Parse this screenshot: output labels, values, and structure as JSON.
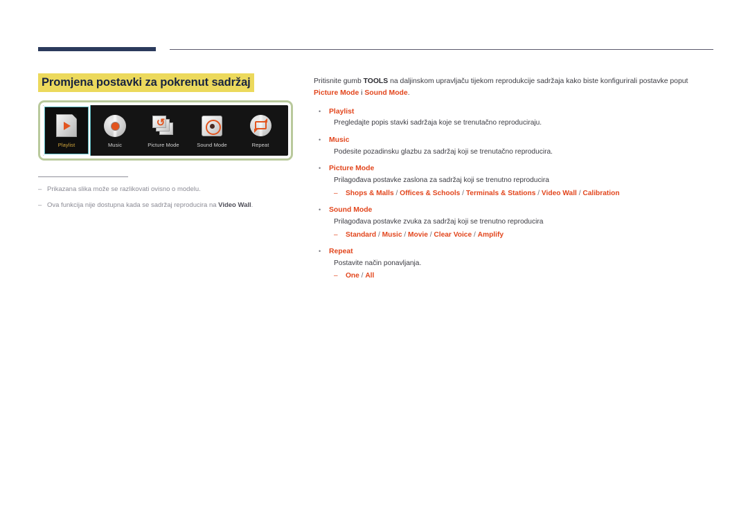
{
  "header": {
    "rule_accent_color": "#2b3a5c",
    "rule_line_color": "#59576b"
  },
  "left": {
    "title": "Promjena postavki za pokrenut sadržaj",
    "title_highlight_color": "#ecd95c",
    "title_text_color": "#18233f",
    "device": {
      "menu_items": [
        {
          "label": "Playlist",
          "icon": "playlist-file-play-icon",
          "selected": true
        },
        {
          "label": "Music",
          "icon": "music-disc-icon",
          "selected": false
        },
        {
          "label": "Picture Mode",
          "icon": "picture-mode-stack-refresh-icon",
          "selected": false
        },
        {
          "label": "Sound Mode",
          "icon": "sound-mode-speaker-icon",
          "selected": false
        },
        {
          "label": "Repeat",
          "icon": "repeat-loop-icon",
          "selected": false
        }
      ],
      "frame_border_color": "#b9c99c",
      "screen_background": "#141414",
      "selected_highlight_color": "#57b8bf",
      "selected_label_color": "#d2a63c"
    },
    "notes": [
      {
        "dash": "–",
        "text_before": "Prikazana slika može se razlikovati ovisno o modelu.",
        "bold": "",
        "text_after": ""
      },
      {
        "dash": "–",
        "text_before": "Ova funkcija nije dostupna kada se sadržaj reproducira na ",
        "bold": "Video Wall",
        "text_after": "."
      }
    ]
  },
  "right": {
    "intro": {
      "part1": "Pritisnite gumb ",
      "bold_key": "TOOLS",
      "part2": " na daljinskom upravljaču tijekom reprodukcije sadržaja kako biste konfigurirali postavke poput ",
      "red1": "Picture Mode",
      "part3": " i ",
      "red2": "Sound Mode",
      "part4": "."
    },
    "bullet_glyph": "•",
    "sub_dash_glyph": "–",
    "items": [
      {
        "title": "Playlist",
        "desc": "Pregledajte popis stavki sadržaja koje se trenutačno reproduciraju.",
        "options": []
      },
      {
        "title": "Music",
        "desc": "Podesite pozadinsku glazbu za sadržaj koji se trenutačno reproducira.",
        "options": []
      },
      {
        "title": "Picture Mode",
        "desc": "Prilagođava postavke zaslona za sadržaj koji se trenutno reproducira",
        "options": [
          "Shops & Malls",
          "Offices & Schools",
          "Terminals & Stations",
          "Video Wall",
          "Calibration"
        ]
      },
      {
        "title": "Sound Mode",
        "desc": "Prilagođava postavke zvuka za sadržaj koji se trenutno reproducira",
        "options": [
          "Standard",
          "Music",
          "Movie",
          "Clear Voice",
          "Amplify"
        ]
      },
      {
        "title": "Repeat",
        "desc": "Postavite način ponavljanja.",
        "options": [
          "One",
          "All"
        ]
      }
    ],
    "accent_color": "#e2461d",
    "body_color": "#3b3b42"
  }
}
